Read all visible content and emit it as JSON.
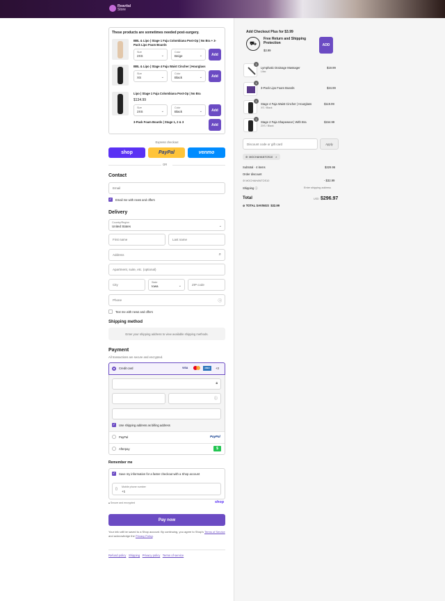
{
  "brand": {
    "name": "Reavital",
    "sub": "Store"
  },
  "upsell": {
    "heading": "These products are sometimes needed post-surgery.",
    "items": [
      {
        "title": "BBL & Lipo | Stage 1 Faja Colombiana Post-Op | No Bra + 3-Pack Lipo Foam Boards",
        "size_label": "Size",
        "size": "2XS",
        "color_label": "Color",
        "color": "Beige",
        "btn": "Add"
      },
      {
        "title": "BBL & Lipo | Stage 4 Faja Waist Cincher | Hourglass",
        "size_label": "Size",
        "size": "XS",
        "color_label": "Color",
        "color": "Black",
        "btn": "Add"
      },
      {
        "title": "Lipo | Stage 1 Faja Colombiana Post-Op | No Bra",
        "price": "$134.99",
        "size_label": "Size",
        "size": "2XS",
        "color_label": "Color",
        "color": "Black",
        "btn": "Add"
      },
      {
        "title": "3-Pack Foam Boards | Stage 1, 2 & 3",
        "btn": "Add"
      }
    ]
  },
  "express": {
    "label": "Express checkout",
    "shop": "shop",
    "paypal": "PayPal",
    "venmo": "venmo",
    "or": "OR"
  },
  "contact": {
    "heading": "Contact",
    "email_placeholder": "Email",
    "news": "Email me with news and offers"
  },
  "delivery": {
    "heading": "Delivery",
    "country_label": "Country/Region",
    "country": "United States",
    "first": "First name",
    "last": "Last name",
    "address": "Address",
    "apt": "Apartment, suite, etc. (optional)",
    "city": "City",
    "state_label": "State",
    "state": "Iowa",
    "zip": "ZIP code",
    "phone": "Phone",
    "text_me": "Text me with news and offers"
  },
  "shipping": {
    "heading": "Shipping method",
    "note": "Enter your shipping address to view available shipping methods."
  },
  "payment": {
    "heading": "Payment",
    "sub": "All transactions are secure and encrypted.",
    "credit": "Credit card",
    "visa": "VISA",
    "amex": "AMEX",
    "more": "+3",
    "billing": "Use shipping address as billing address",
    "paypal": "PayPal",
    "paypal_logo": "PayPal",
    "afterpay": "Afterpay",
    "afterpay_logo": "$"
  },
  "remember": {
    "heading": "Remember me",
    "save": "Save my information for a faster checkout with a Shop account",
    "mobile_label": "Mobile phone number",
    "mobile": "+1",
    "secure": "Secure and encrypted",
    "shop": "shop"
  },
  "paynow": "Pay now",
  "legal": {
    "text": "Your info will be saved to a Shop account. By continuing, you agree to Shop's",
    "tos": "Terms of Service",
    "and": "and acknowledge the",
    "privacy": "Privacy Policy",
    "dot": "."
  },
  "footer": [
    "Refund policy",
    "Shipping",
    "Privacy policy",
    "Terms of service"
  ],
  "summary": {
    "addon_heading": "Add Checkout Plus for $3.99",
    "addon_title": "Free Return and Shipping Protection",
    "addon_price": "$3.99",
    "addon_btn": "ADD",
    "items": [
      {
        "qty": "1",
        "name": "Lymphatic Drainage Massager",
        "variant": "Lilac",
        "price": "$19.99"
      },
      {
        "qty": "1",
        "name": "3-Pack Lipo Foam Boards",
        "variant": "",
        "price": "$34.99"
      },
      {
        "qty": "1",
        "name": "Stage 4 Faja Waist Cincher | Hourglass",
        "variant": "XS / Black",
        "price": "$119.99"
      },
      {
        "qty": "1",
        "name": "Stage 2 Faja Shapewear | With Bra",
        "variant": "2XS / Black",
        "price": "$154.99"
      }
    ],
    "discount_placeholder": "Discount code or gift card",
    "apply": "Apply",
    "code": "MOCHAHANTOS10",
    "subtotal_label": "Subtotal · 4 items",
    "subtotal": "$329.96",
    "order_discount": "Order discount",
    "discount_code": "MOCHAHANTOS10",
    "discount_amt": "- $32.99",
    "shipping_label": "Shipping",
    "shipping_val": "Enter shipping address",
    "total_label": "Total",
    "currency": "USD",
    "total": "$296.97",
    "savings_label": "TOTAL SAVINGS",
    "savings": "$32.99"
  },
  "colors": {
    "accent": "#6b4bc3",
    "shop": "#5a31f4",
    "paypal": "#ffc439",
    "venmo": "#008cff",
    "afterpay": "#b2fce4"
  }
}
